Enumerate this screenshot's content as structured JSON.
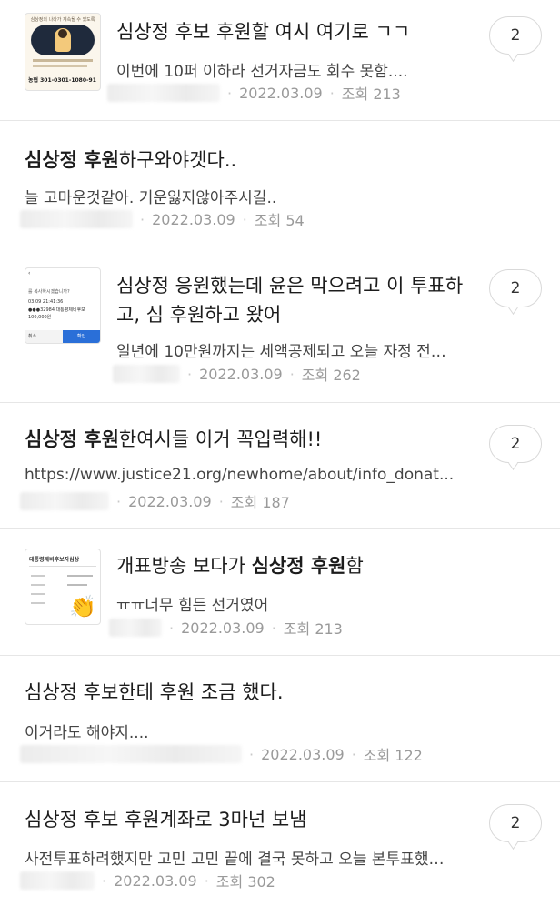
{
  "posts": [
    {
      "title_plain": "심상정 후보 후원할 여시 여기로 ㄱㄱ",
      "summary": "이번에 10퍼 이하라 선거자금도 회수 못함....",
      "date": "2022.03.09",
      "views": "조회 213",
      "comments": "2",
      "thumbnail": {
        "caption": "심상정의 나라가 계속될 수 있도록",
        "account": "농협 301-0301-1080-91",
        "icon": "campaign-poster"
      }
    },
    {
      "title_bold": "심상정 후원",
      "title_rest": "하구와야겟다..",
      "summary": "늘 고마운것같아. 기운잃지않아주시길..",
      "date": "2022.03.09",
      "views": "조회 54"
    },
    {
      "title_plain": "심상정 응원했는데 윤은 막으려고 이 투표하고, 심 후원하고 왔어",
      "summary": "일년에 10만원까지는 세액공제되고 오늘 자정 전…",
      "date": "2022.03.09",
      "views": "조회 262",
      "comments": "2",
      "thumbnail": {
        "dialog_text": "를 복사하시겠습니까?",
        "line1": "03.09 21:41:36",
        "line2": "●●●32984 대통령제비후보",
        "line3": "100,000원",
        "cancel": "취소",
        "confirm": "확인"
      }
    },
    {
      "title_bold": "심상정 후원",
      "title_rest": "한여시들 이거 꼭입력해!!",
      "summary": "https://www.justice21.org/newhome/about/info_donat...",
      "date": "2022.03.09",
      "views": "조회 187",
      "comments": "2"
    },
    {
      "title_prefix": "개표방송 보다가 ",
      "title_bold": "심상정 후원",
      "title_rest": "함",
      "summary": "ㅠㅠ너무 힘든 선거였어",
      "date": "2022.03.09",
      "views": "조회 213",
      "thumbnail": {
        "header": "대통령제비후보자심상",
        "icon": "clapping-hands"
      }
    },
    {
      "title_plain": "심상정 후보한테 후원 조금 했다.",
      "summary": "이거라도 해야지....",
      "date": "2022.03.09",
      "views": "조회 122"
    },
    {
      "title_plain": "심상정 후보 후원계좌로 3마넌 보냄",
      "summary": "사전투표하려했지만 고민 고민 끝에 결국 못하고 오늘 본투표했…",
      "date": "2022.03.09",
      "views": "조회 302",
      "comments": "2"
    }
  ]
}
